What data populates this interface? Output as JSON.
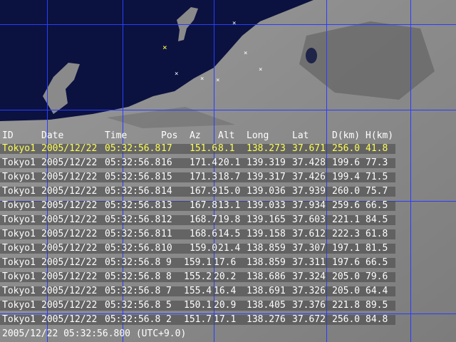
{
  "table": {
    "headers": [
      "ID",
      "Date",
      "Time",
      "Pos",
      "Az",
      "Alt",
      "Long",
      "Lat",
      "D(km)",
      "H(km)"
    ],
    "rows": [
      [
        "Tokyo1",
        "2005/12/22",
        "05:32:56.8",
        "17",
        "151.6",
        "8.1",
        "138.273",
        "37.671",
        "256.0",
        "41.8"
      ],
      [
        "Tokyo1",
        "2005/12/22",
        "05:32:56.8",
        "16",
        "171.4",
        "20.1",
        "139.319",
        "37.428",
        "199.6",
        "77.3"
      ],
      [
        "Tokyo1",
        "2005/12/22",
        "05:32:56.8",
        "15",
        "171.3",
        "18.7",
        "139.317",
        "37.426",
        "199.4",
        "71.5"
      ],
      [
        "Tokyo1",
        "2005/12/22",
        "05:32:56.8",
        "14",
        "167.9",
        "15.0",
        "139.036",
        "37.939",
        "260.0",
        "75.7"
      ],
      [
        "Tokyo1",
        "2005/12/22",
        "05:32:56.8",
        "13",
        "167.8",
        "13.1",
        "139.033",
        "37.934",
        "259.6",
        "66.5"
      ],
      [
        "Tokyo1",
        "2005/12/22",
        "05:32:56.8",
        "12",
        "168.7",
        "19.8",
        "139.165",
        "37.603",
        "221.1",
        "84.5"
      ],
      [
        "Tokyo1",
        "2005/12/22",
        "05:32:56.8",
        "11",
        "168.6",
        "14.5",
        "139.158",
        "37.612",
        "222.3",
        "61.8"
      ],
      [
        "Tokyo1",
        "2005/12/22",
        "05:32:56.8",
        "10",
        "159.0",
        "21.4",
        "138.859",
        "37.307",
        "197.1",
        "81.5"
      ],
      [
        "Tokyo1",
        "2005/12/22",
        "05:32:56.8",
        "9",
        "159.1",
        "17.6",
        "138.859",
        "37.311",
        "197.6",
        "66.5"
      ],
      [
        "Tokyo1",
        "2005/12/22",
        "05:32:56.8",
        "8",
        "155.2",
        "20.2",
        "138.686",
        "37.324",
        "205.0",
        "79.6"
      ],
      [
        "Tokyo1",
        "2005/12/22",
        "05:32:56.8",
        "7",
        "155.4",
        "16.4",
        "138.691",
        "37.326",
        "205.0",
        "64.4"
      ],
      [
        "Tokyo1",
        "2005/12/22",
        "05:32:56.8",
        "5",
        "150.1",
        "20.9",
        "138.405",
        "37.376",
        "221.8",
        "89.5"
      ],
      [
        "Tokyo1",
        "2005/12/22",
        "05:32:56.8",
        "2",
        "151.7",
        "17.1",
        "138.276",
        "37.672",
        "256.0",
        "84.8"
      ]
    ],
    "selected_row_index": 0
  },
  "status_bar": {
    "text": "2005/12/22 05:32:56.800 (UTC+9.0)"
  },
  "map": {
    "marker_symbol": "×",
    "selected_marker_symbol": "×"
  },
  "colors": {
    "sea": "#0b1240",
    "grid": "#2a3cff",
    "text": "#ffffff",
    "selected_text": "#ffff55"
  }
}
